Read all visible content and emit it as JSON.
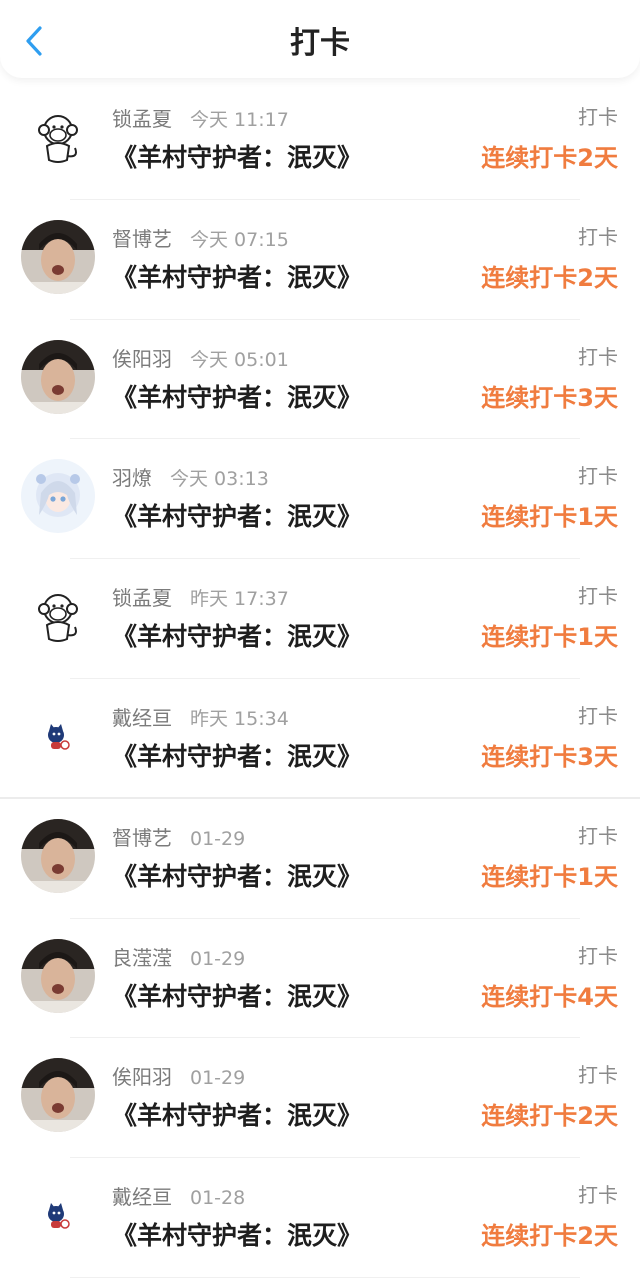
{
  "header": {
    "title": "打卡",
    "back_icon": "chevron-left-icon",
    "accent": "#2f9ef0"
  },
  "colors": {
    "streak": "#f07c3f"
  },
  "items": [
    {
      "name": "锁孟夏",
      "time": "今天 11:17",
      "book": "《羊村守护者：泯灭》",
      "kind": "打卡",
      "streak": "连续打卡2天",
      "avatar": "monkey-avatar"
    },
    {
      "name": "督博艺",
      "time": "今天 07:15",
      "book": "《羊村守护者：泯灭》",
      "kind": "打卡",
      "streak": "连续打卡2天",
      "avatar": "photo-avatar"
    },
    {
      "name": "俟阳羽",
      "time": "今天 05:01",
      "book": "《羊村守护者：泯灭》",
      "kind": "打卡",
      "streak": "连续打卡3天",
      "avatar": "photo-avatar"
    },
    {
      "name": "羽燎",
      "time": "今天 03:13",
      "book": "《羊村守护者：泯灭》",
      "kind": "打卡",
      "streak": "连续打卡1天",
      "avatar": "anime-avatar"
    },
    {
      "name": "锁孟夏",
      "time": "昨天 17:37",
      "book": "《羊村守护者：泯灭》",
      "kind": "打卡",
      "streak": "连续打卡1天",
      "avatar": "monkey-avatar"
    },
    {
      "name": "戴经亘",
      "time": "昨天 15:34",
      "book": "《羊村守护者：泯灭》",
      "kind": "打卡",
      "streak": "连续打卡3天",
      "avatar": "cartoon-avatar"
    },
    {
      "name": "督博艺",
      "time": "01-29",
      "book": "《羊村守护者：泯灭》",
      "kind": "打卡",
      "streak": "连续打卡1天",
      "avatar": "photo-avatar"
    },
    {
      "name": "良滢滢",
      "time": "01-29",
      "book": "《羊村守护者：泯灭》",
      "kind": "打卡",
      "streak": "连续打卡4天",
      "avatar": "photo-avatar"
    },
    {
      "name": "俟阳羽",
      "time": "01-29",
      "book": "《羊村守护者：泯灭》",
      "kind": "打卡",
      "streak": "连续打卡2天",
      "avatar": "photo-avatar"
    },
    {
      "name": "戴经亘",
      "time": "01-28",
      "book": "《羊村守护者：泯灭》",
      "kind": "打卡",
      "streak": "连续打卡2天",
      "avatar": "cartoon-avatar"
    }
  ]
}
